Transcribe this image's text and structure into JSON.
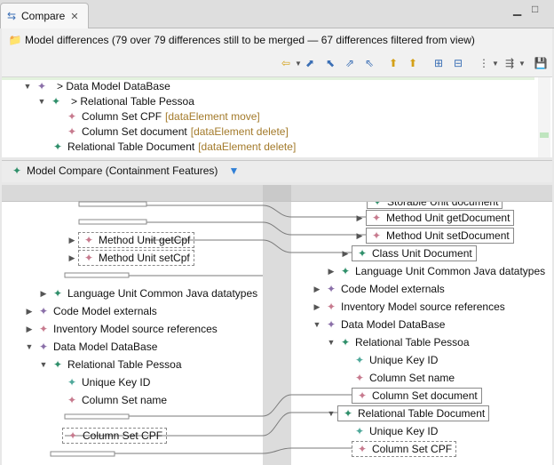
{
  "tab": {
    "label": "Compare"
  },
  "header": {
    "title": "Model differences  (79 over 79 differences still to be merged — 67 differences filtered from view)"
  },
  "tree": [
    {
      "label": "> Data Model DataBase",
      "tag": ""
    },
    {
      "label": "> Relational Table Pessoa",
      "tag": ""
    },
    {
      "label": "Column Set CPF",
      "tag": "[dataElement move]"
    },
    {
      "label": "Column Set document",
      "tag": "[dataElement delete]"
    },
    {
      "label": "Relational Table Document",
      "tag": "[dataElement delete]"
    }
  ],
  "compare": {
    "title": "Model Compare (Containment Features)"
  },
  "left": [
    "Method Unit getCpf",
    "Method Unit setCpf",
    "Language Unit Common Java datatypes",
    "Code Model externals",
    "Inventory Model source references",
    "Data Model DataBase",
    "Relational Table Pessoa",
    "Unique Key ID",
    "Column Set name",
    "Column Set CPF"
  ],
  "right": [
    "Storable Unit document",
    "Method Unit getDocument",
    "Method Unit setDocument",
    "Class Unit Document",
    "Language Unit Common Java datatypes",
    "Code Model externals",
    "Inventory Model source references",
    "Data Model DataBase",
    "Relational Table Pessoa",
    "Unique Key ID",
    "Column Set name",
    "Column Set document",
    "Relational Table Document",
    "Unique Key ID",
    "Column Set CPF"
  ]
}
